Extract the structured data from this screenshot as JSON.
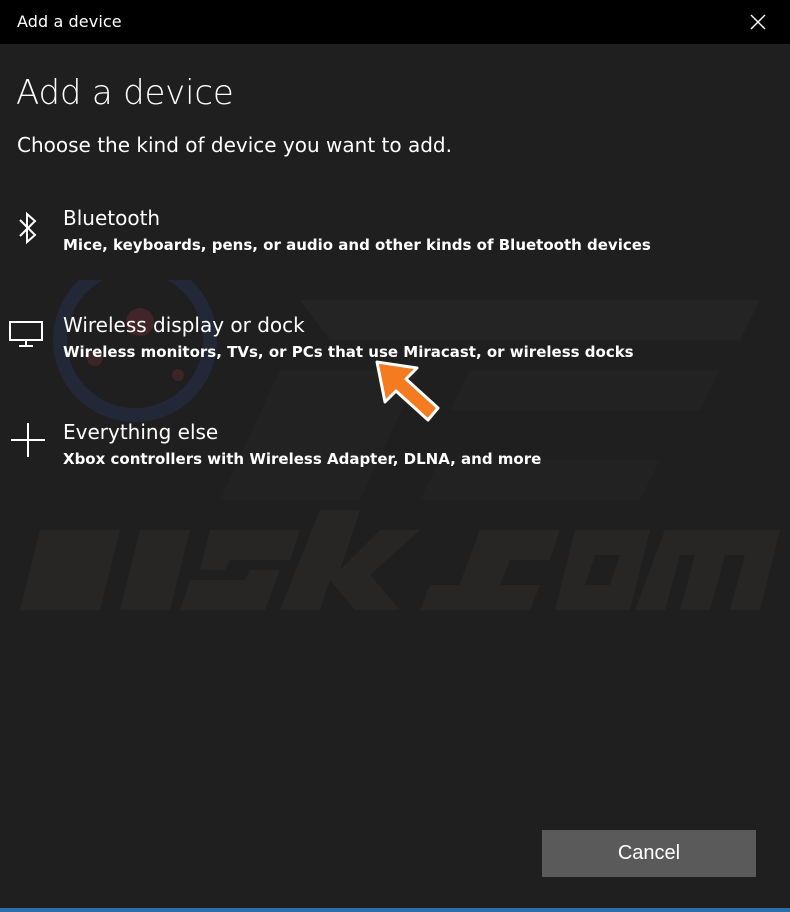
{
  "window": {
    "title": "Add a device"
  },
  "main": {
    "heading": "Add a device",
    "subheading": "Choose the kind of device you want to add."
  },
  "options": [
    {
      "title": "Bluetooth",
      "description": "Mice, keyboards, pens, or audio and other kinds of Bluetooth devices",
      "icon": "bluetooth-icon"
    },
    {
      "title": "Wireless display or dock",
      "description": "Wireless monitors, TVs, or PCs that use Miracast, or wireless docks",
      "icon": "monitor-icon"
    },
    {
      "title": "Everything else",
      "description": "Xbox controllers with Wireless Adapter, DLNA, and more",
      "icon": "plus-icon"
    }
  ],
  "footer": {
    "cancel_label": "Cancel"
  },
  "colors": {
    "titlebar": "#000000",
    "background": "#1f1f1f",
    "button": "#5a5a5a",
    "annotation_arrow": "#f47b20"
  }
}
